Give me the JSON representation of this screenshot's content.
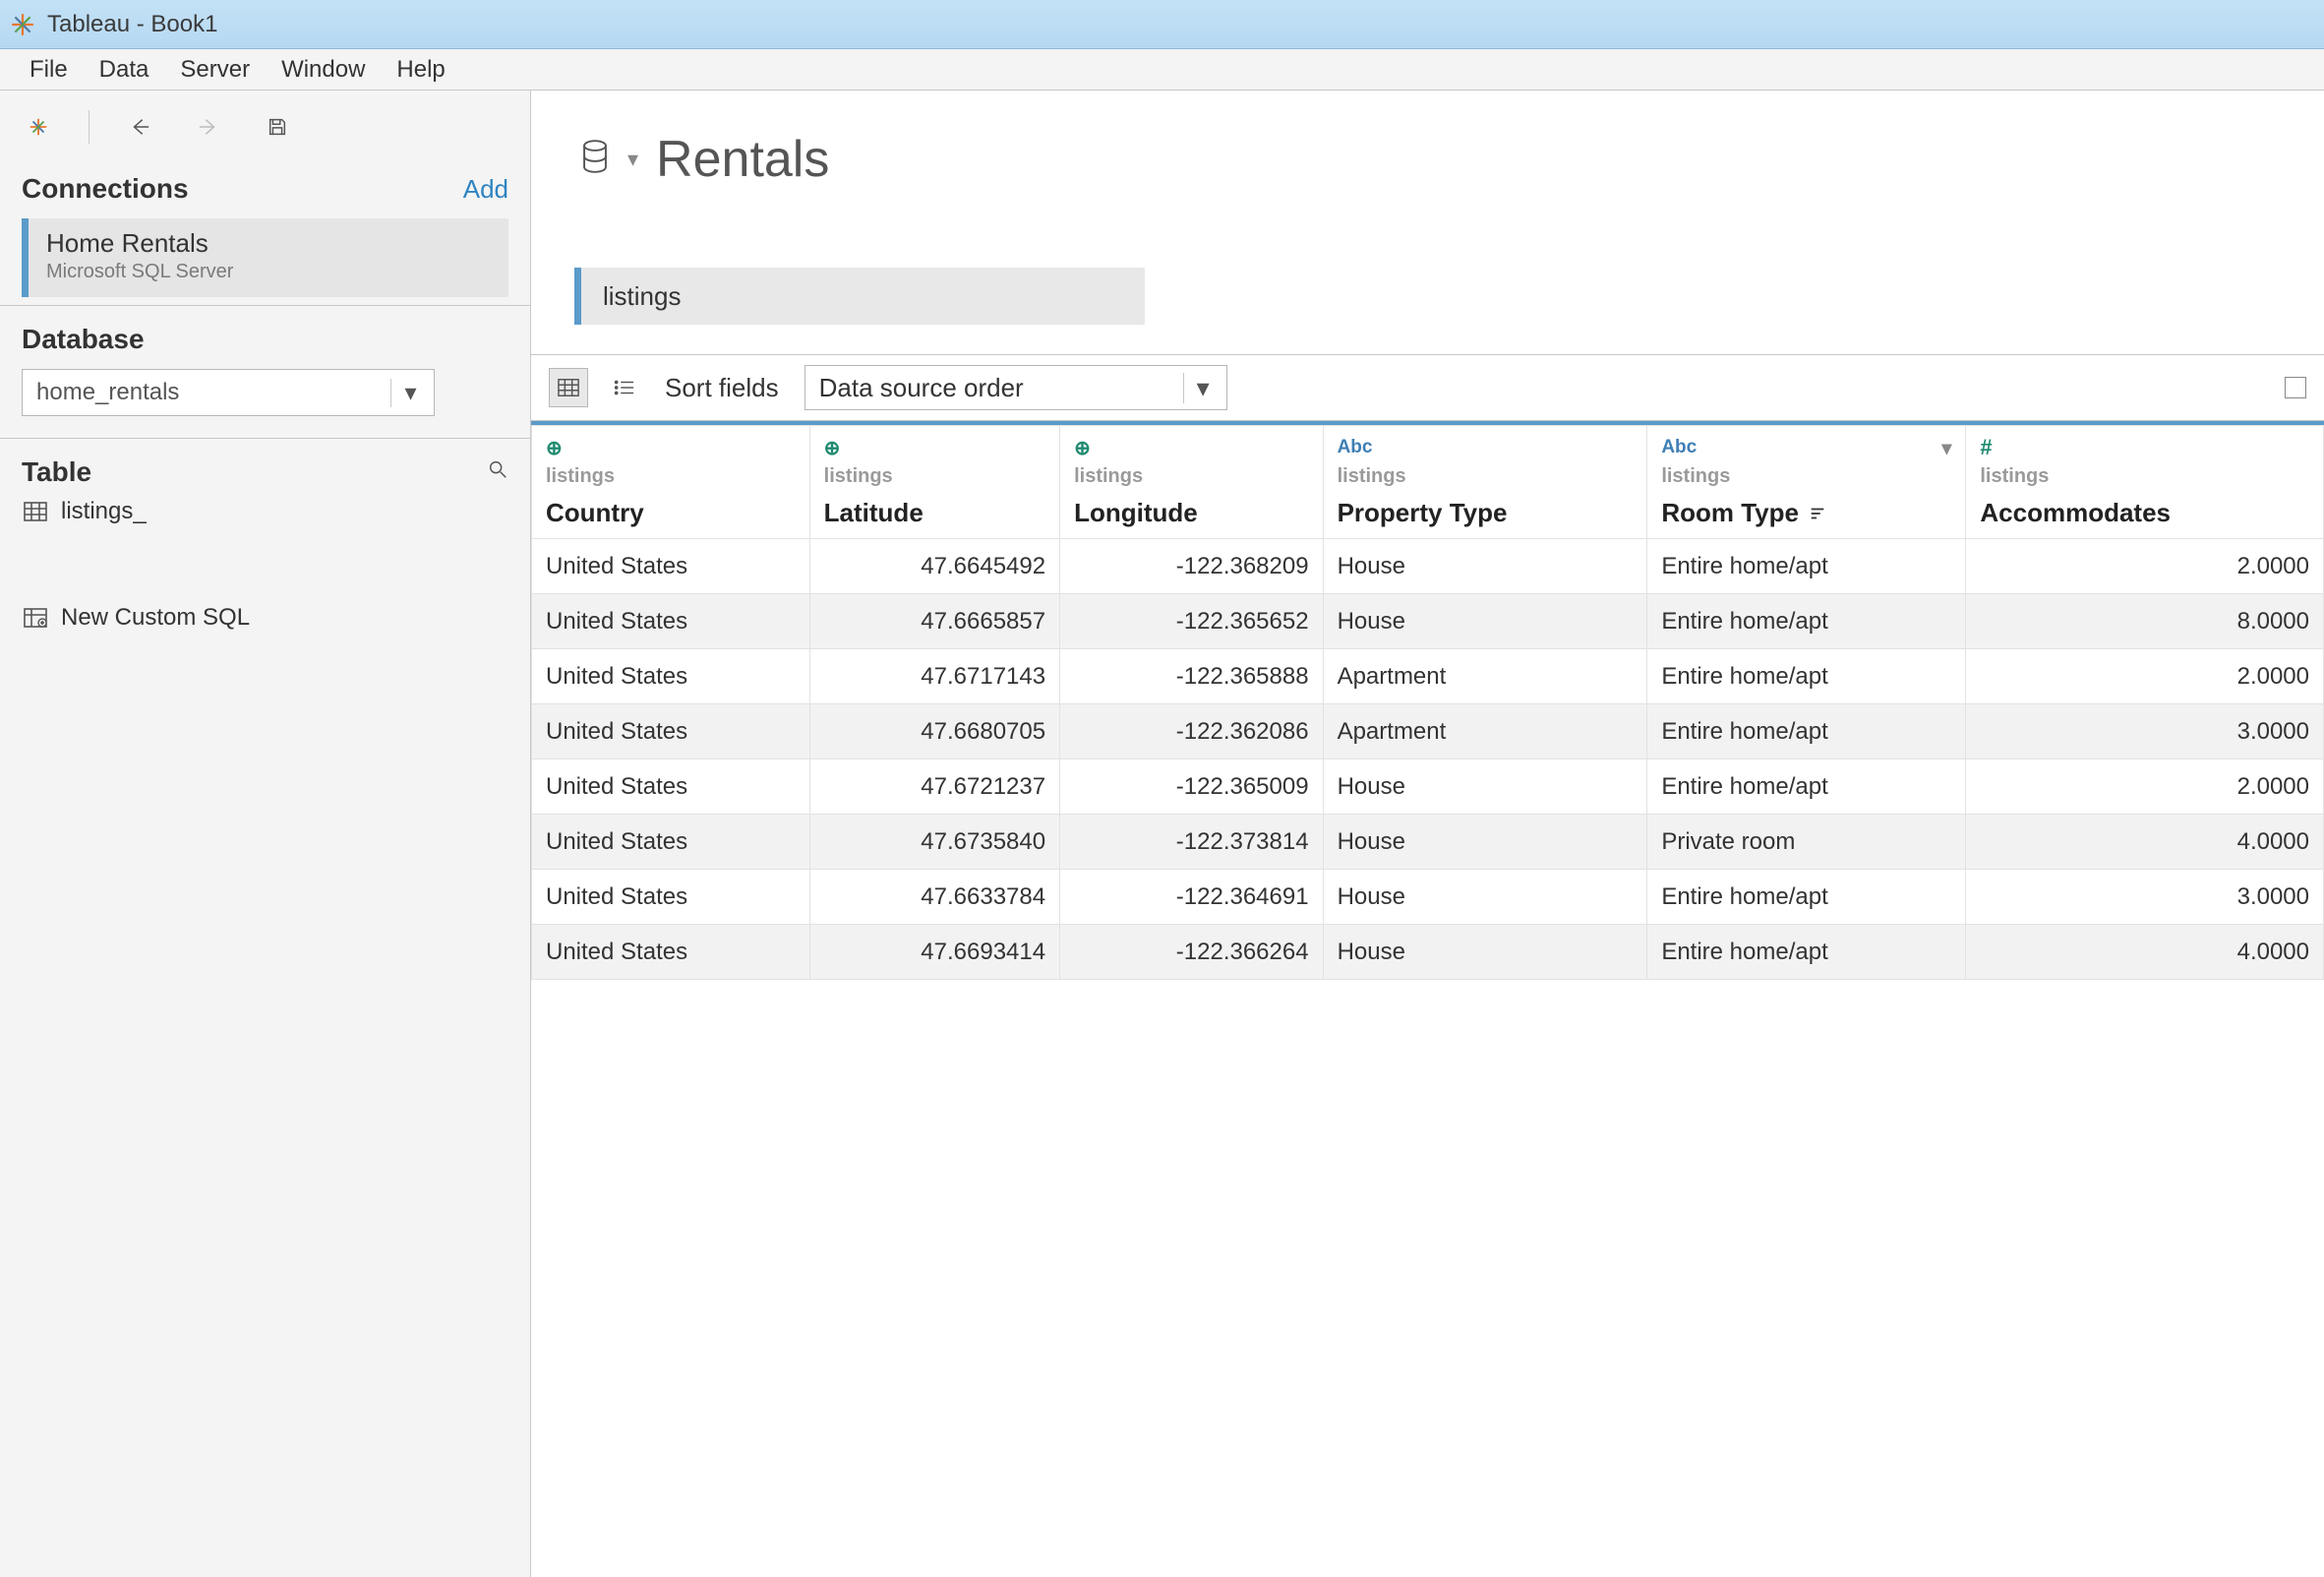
{
  "window": {
    "title": "Tableau - Book1"
  },
  "menu": {
    "items": [
      "File",
      "Data",
      "Server",
      "Window",
      "Help"
    ]
  },
  "sidebar": {
    "connections": {
      "header": "Connections",
      "add": "Add",
      "items": [
        {
          "name": "Home Rentals",
          "subtitle": "Microsoft SQL Server"
        }
      ]
    },
    "database": {
      "header": "Database",
      "selected": "home_rentals"
    },
    "table": {
      "header": "Table",
      "items": [
        {
          "name": "listings_"
        }
      ],
      "newCustomSql": "New Custom SQL"
    }
  },
  "main": {
    "datasource": {
      "title": "Rentals",
      "canvasTable": "listings"
    },
    "toolbar": {
      "sortLabel": "Sort fields",
      "sortValue": "Data source order"
    }
  },
  "grid": {
    "columns": [
      {
        "key": "country",
        "type": "geo",
        "source": "listings",
        "name": "Country",
        "align": "left"
      },
      {
        "key": "lat",
        "type": "geo",
        "source": "listings",
        "name": "Latitude",
        "align": "right"
      },
      {
        "key": "lon",
        "type": "geo",
        "source": "listings",
        "name": "Longitude",
        "align": "right"
      },
      {
        "key": "ptype",
        "type": "str",
        "source": "listings",
        "name": "Property Type",
        "align": "left"
      },
      {
        "key": "rtype",
        "type": "str",
        "source": "listings",
        "name": "Room Type",
        "align": "left",
        "menu": true,
        "sorted": true
      },
      {
        "key": "acc",
        "type": "num",
        "source": "listings",
        "name": "Accommodates",
        "align": "right"
      }
    ],
    "rows": [
      {
        "country": "United States",
        "lat": "47.6645492",
        "lon": "-122.368209",
        "ptype": "House",
        "rtype": "Entire home/apt",
        "acc": "2.0000"
      },
      {
        "country": "United States",
        "lat": "47.6665857",
        "lon": "-122.365652",
        "ptype": "House",
        "rtype": "Entire home/apt",
        "acc": "8.0000"
      },
      {
        "country": "United States",
        "lat": "47.6717143",
        "lon": "-122.365888",
        "ptype": "Apartment",
        "rtype": "Entire home/apt",
        "acc": "2.0000"
      },
      {
        "country": "United States",
        "lat": "47.6680705",
        "lon": "-122.362086",
        "ptype": "Apartment",
        "rtype": "Entire home/apt",
        "acc": "3.0000"
      },
      {
        "country": "United States",
        "lat": "47.6721237",
        "lon": "-122.365009",
        "ptype": "House",
        "rtype": "Entire home/apt",
        "acc": "2.0000"
      },
      {
        "country": "United States",
        "lat": "47.6735840",
        "lon": "-122.373814",
        "ptype": "House",
        "rtype": "Private room",
        "acc": "4.0000"
      },
      {
        "country": "United States",
        "lat": "47.6633784",
        "lon": "-122.364691",
        "ptype": "House",
        "rtype": "Entire home/apt",
        "acc": "3.0000"
      },
      {
        "country": "United States",
        "lat": "47.6693414",
        "lon": "-122.366264",
        "ptype": "House",
        "rtype": "Entire home/apt",
        "acc": "4.0000"
      }
    ]
  }
}
